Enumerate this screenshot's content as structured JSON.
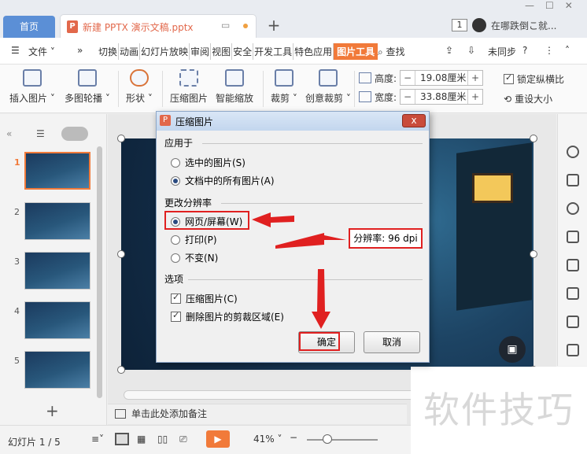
{
  "titlebar": {
    "home_tab": "首页",
    "doc_tab": "新建 PPTX 演示文稿.pptx",
    "ppt_icon": "P",
    "add_tab": "+",
    "badge": "1",
    "user_text": "在哪跌倒こ就...",
    "win_controls": [
      "—",
      "☐",
      "✕"
    ]
  },
  "menubar": {
    "file_menu": "文件",
    "expand": "»",
    "tabs": [
      "切换",
      "动画",
      "幻灯片放映",
      "审阅",
      "视图",
      "安全",
      "开发工具",
      "特色应用",
      "图片工具"
    ],
    "active_tab": "图片工具",
    "search": "查找",
    "sync": "未同步",
    "help": "?"
  },
  "ribbon": {
    "buttons": [
      {
        "label": "插入图片"
      },
      {
        "label": "多图轮播"
      },
      {
        "label": "形状"
      },
      {
        "label": "压缩图片"
      },
      {
        "label": "智能缩放"
      },
      {
        "label": "裁剪"
      },
      {
        "label": "创意裁剪"
      }
    ],
    "height_label": "高度:",
    "height_value": "19.08厘米",
    "width_label": "宽度:",
    "width_value": "33.88厘米",
    "lock_ratio": "锁定纵横比",
    "reset_size": "重设大小",
    "minus": "−",
    "plus": "+"
  },
  "slides": [
    {
      "num": "1",
      "selected": true
    },
    {
      "num": "2",
      "selected": false
    },
    {
      "num": "3",
      "selected": false
    },
    {
      "num": "4",
      "selected": false
    },
    {
      "num": "5",
      "selected": false
    }
  ],
  "left_panel": {
    "add": "+"
  },
  "notes_placeholder": "单击此处添加备注",
  "status": {
    "slide_count": "幻灯片 1 / 5",
    "zoom": "41%"
  },
  "watermark": "软件技巧",
  "dialog": {
    "title": "压缩图片",
    "close": "x",
    "apply_group": "应用于",
    "apply_options": [
      {
        "label": "选中的图片(S)",
        "checked": false
      },
      {
        "label": "文档中的所有图片(A)",
        "checked": true
      }
    ],
    "resolution_group": "更改分辨率",
    "resolution_options": [
      {
        "label": "网页/屏幕(W)",
        "checked": true
      },
      {
        "label": "打印(P)",
        "checked": false
      },
      {
        "label": "不变(N)",
        "checked": false
      }
    ],
    "options_group": "选项",
    "checkbox_options": [
      {
        "label": "压缩图片(C)",
        "checked": true
      },
      {
        "label": "删除图片的剪裁区域(E)",
        "checked": true
      }
    ],
    "ok": "确定",
    "cancel": "取消"
  },
  "annotation": {
    "resolution_text": "分辨率: 96 dpi",
    "accent": "#e02020"
  }
}
